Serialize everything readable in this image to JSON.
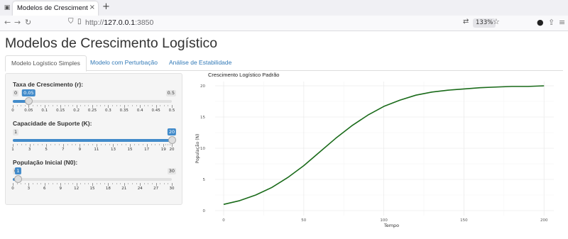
{
  "browser": {
    "tab_title": "Modelos de Crescimento Logístico",
    "tab_close": "×",
    "new_tab": "+",
    "url_scheme": "http://",
    "url_host": "127.0.0.1",
    "url_port": ":3850",
    "zoom": "133%",
    "icons": [
      "tab-list-icon",
      "back-icon",
      "forward-icon",
      "reload-icon",
      "shield-icon",
      "page-icon",
      "translate-icon",
      "star-icon",
      "extension-icon",
      "share-icon",
      "menu-icon"
    ]
  },
  "app": {
    "title": "Modelos de Crescimento Logístico",
    "tabs": [
      {
        "label": "Modelo Logístico Simples"
      },
      {
        "label": "Modelo com Perturbação"
      },
      {
        "label": "Análise de Estabilidade"
      }
    ]
  },
  "sliders": [
    {
      "label": "Taxa de Crescimento (r):",
      "min": 0,
      "max": 0.5,
      "value": 0.05,
      "min_label": "0",
      "max_label": "0.5",
      "value_label": "0.05",
      "ticks": [
        "0",
        "0.05",
        "0.1",
        "0.15",
        "0.2",
        "0.25",
        "0.3",
        "0.35",
        "0.4",
        "0.45",
        "0.5"
      ]
    },
    {
      "label": "Capacidade de Suporte (K):",
      "min": 1,
      "max": 20,
      "value": 20,
      "min_label": "1",
      "max_label": "20",
      "value_label": "20",
      "ticks": [
        "1",
        "3",
        "5",
        "7",
        "9",
        "11",
        "13",
        "15",
        "17",
        "19",
        "20"
      ]
    },
    {
      "label": "População Inicial (N0):",
      "min": 0,
      "max": 30,
      "value": 1,
      "min_label": "0",
      "max_label": "30",
      "value_label": "1",
      "ticks": [
        "0",
        "3",
        "6",
        "9",
        "12",
        "15",
        "18",
        "21",
        "24",
        "27",
        "30"
      ]
    }
  ],
  "chart_data": {
    "type": "line",
    "title": "Crescimento Logístico Padrão",
    "xlabel": "Tempo",
    "ylabel": "População (N)",
    "xlim": [
      0,
      200
    ],
    "ylim": [
      0,
      20
    ],
    "x_ticks": [
      "0",
      "50",
      "100",
      "150",
      "200"
    ],
    "y_ticks": [
      "0",
      "5",
      "10",
      "15",
      "20"
    ],
    "grid": true,
    "series": [
      {
        "color": "#1a6b1a",
        "x": [
          0,
          10,
          20,
          30,
          40,
          50,
          60,
          70,
          80,
          90,
          100,
          110,
          120,
          130,
          140,
          150,
          160,
          170,
          180,
          190,
          200
        ],
        "y": [
          1.0,
          1.6,
          2.5,
          3.7,
          5.3,
          7.2,
          9.4,
          11.6,
          13.6,
          15.3,
          16.7,
          17.7,
          18.5,
          19.0,
          19.3,
          19.5,
          19.7,
          19.8,
          19.9,
          19.9,
          20.0
        ]
      }
    ]
  }
}
